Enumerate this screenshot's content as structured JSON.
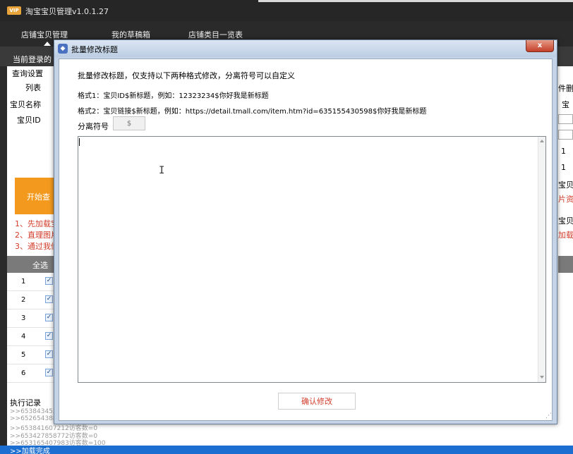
{
  "app": {
    "badge": "VIP",
    "title": "淘宝宝贝管理v1.0.1.27",
    "nav": [
      "店铺宝贝管理",
      "我的草稿箱",
      "店铺类目一览表"
    ],
    "login_label": "当前登录的",
    "query_settings": "查询设置",
    "list_label": "列表",
    "product_name_label": "宝贝名称",
    "product_id_label": "宝贝ID",
    "start_button": "开始查",
    "steps": [
      "1、先加载宝",
      "2、直理图片",
      "3、通过我们"
    ],
    "select_all": "全选",
    "rows": [
      "1",
      "2",
      "3",
      "4",
      "5",
      "6"
    ],
    "log_title": "执行记录",
    "log_lines": [
      ">>6538434535",
      ">>6526543886",
      ">>653841607212访客数=0",
      ">>653427858772访客数=0",
      ">>653165407983访客数=100"
    ],
    "status": ">>加载完成",
    "right_fragments": [
      "件删",
      "宝",
      "1",
      "1",
      "宝贝",
      "片资",
      "宝贝",
      "加载"
    ]
  },
  "dialog": {
    "title": "批量修改标题",
    "close_label": "x",
    "description": "批量修改标题，仅支持以下两种格式修改，分离符号可以自定义",
    "format1": "格式1：宝贝ID$新标题，例如：12323234$你好我是新标题",
    "format2": "格式2：宝贝链接$新标题，例如：https://detail.tmall.com/item.htm?id=635155430598$你好我是新标题",
    "separator_label": "分离符号",
    "separator_value": "$",
    "textarea_value": "",
    "confirm_label": "确认修改"
  },
  "colors": {
    "accent_orange": "#f39a1e",
    "status_blue": "#1c6fd1",
    "confirm_text": "#d23c2a"
  }
}
